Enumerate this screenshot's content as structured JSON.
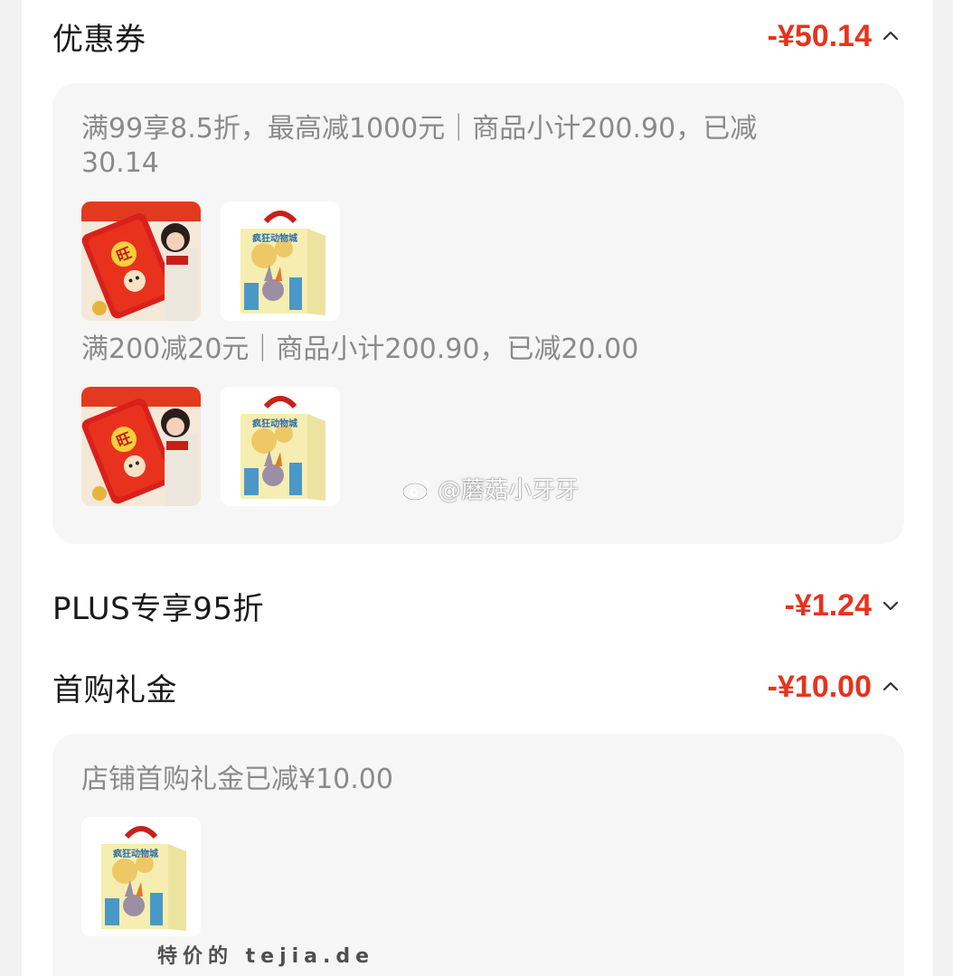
{
  "coupon": {
    "title": "优惠券",
    "amount": "-¥50.14",
    "expanded": true,
    "rules": [
      {
        "text": "满99享8.5折，最高减1000元｜商品小计200.90，已减30.14",
        "products": [
          "wangwang-snack-bag",
          "zootopia-cookie-box"
        ]
      },
      {
        "text": "满200减20元｜商品小计200.90，已减20.00",
        "products": [
          "wangwang-snack-bag",
          "zootopia-cookie-box"
        ]
      }
    ]
  },
  "plus": {
    "title": "PLUS专享95折",
    "amount": "-¥1.24",
    "expanded": false
  },
  "first_purchase": {
    "title": "首购礼金",
    "amount": "-¥10.00",
    "expanded": true,
    "rules": [
      {
        "text": "店铺首购礼金已减¥10.00",
        "products": [
          "zootopia-cookie-box"
        ]
      }
    ]
  },
  "watermarks": {
    "weibo": "@蘑菇小牙牙",
    "site": "特价的 tejia.de"
  },
  "colors": {
    "accent_red": "#e8321e",
    "title_text": "#1a1a1a",
    "detail_text": "#8a8a8a",
    "detail_bg": "#f6f6f6"
  }
}
